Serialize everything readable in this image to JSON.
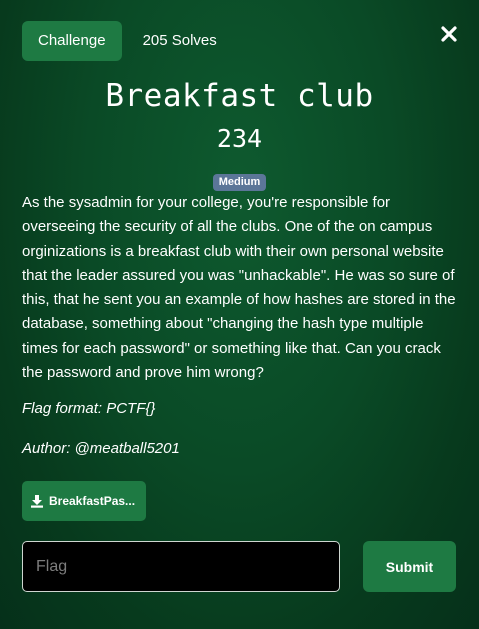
{
  "tabs": {
    "challenge_label": "Challenge",
    "solves_label": "205 Solves"
  },
  "close_icon": "close-icon",
  "challenge": {
    "title": "Breakfast club",
    "points": "234",
    "difficulty": "Medium",
    "description": "As the sysadmin for your college, you're responsible for overseeing the security of all the clubs. One of the on campus orginizations is a breakfast club with their own personal website that the leader assured you was \"unhackable\". He was so sure of this, that he sent you an example of how hashes are stored in the database, something about \"changing the hash type multiple times for each password\" or something like that. Can you crack the password and prove him wrong?",
    "flag_format": "Flag format: PCTF{}",
    "author": "Author: @meatball5201"
  },
  "file": {
    "label": "BreakfastPas...",
    "icon": "download-icon"
  },
  "flag_input": {
    "placeholder": "Flag",
    "value": ""
  },
  "submit_label": "Submit",
  "colors": {
    "accent_green": "#1e7a43",
    "badge": "#5b7698",
    "background": "#0a4a26"
  }
}
